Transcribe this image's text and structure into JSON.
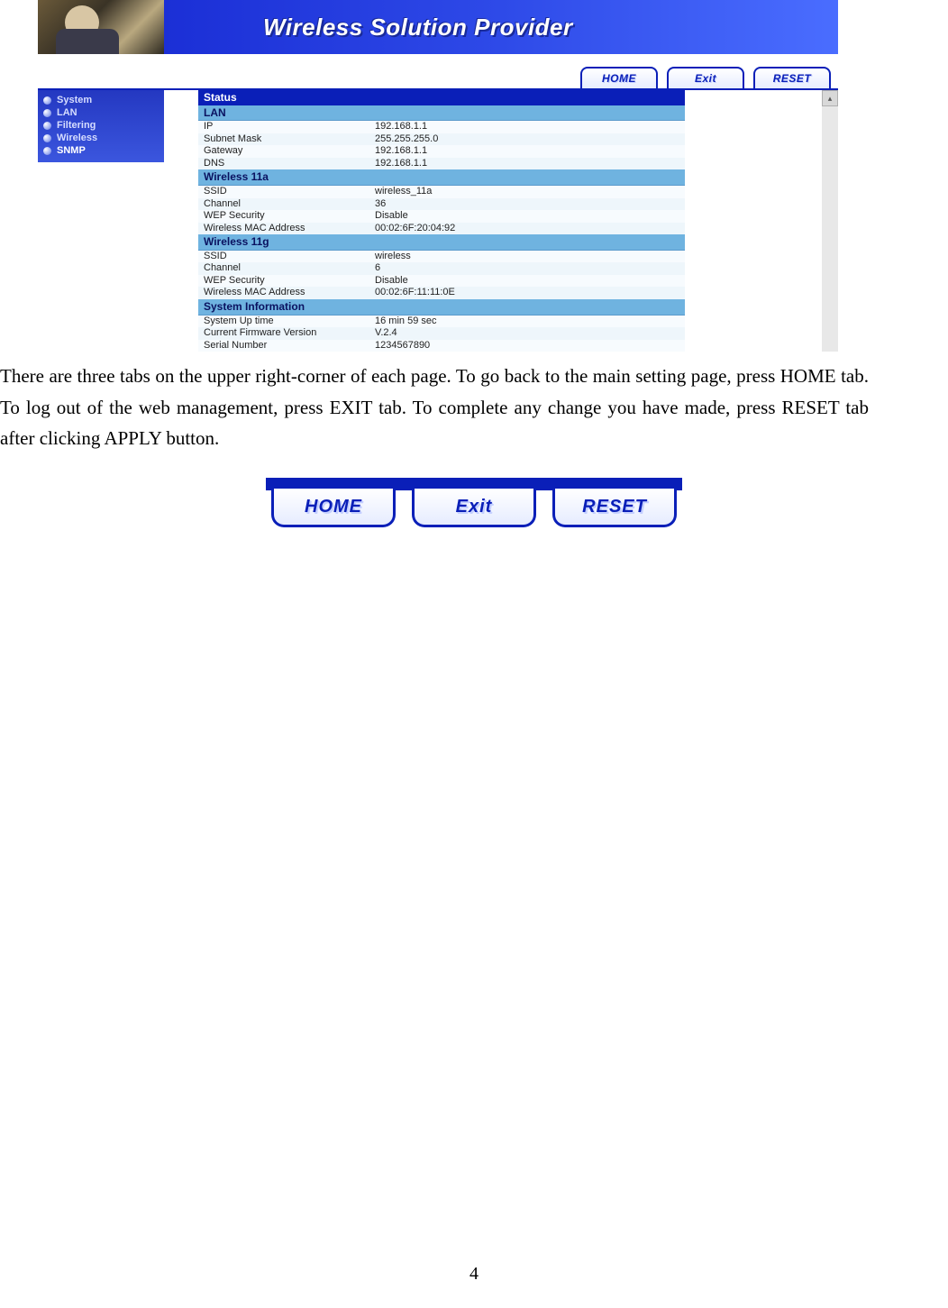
{
  "banner": {
    "title": "Wireless Solution Provider"
  },
  "tabs": {
    "home": "HOME",
    "exit": "Exit",
    "reset": "RESET"
  },
  "sidebar": {
    "items": [
      {
        "label": "System"
      },
      {
        "label": "LAN"
      },
      {
        "label": "Filtering"
      },
      {
        "label": "Wireless"
      },
      {
        "label": "SNMP"
      }
    ]
  },
  "status": {
    "header": "Status",
    "lan": {
      "section": "LAN",
      "ip_k": "IP",
      "ip_v": "192.168.1.1",
      "mask_k": "Subnet Mask",
      "mask_v": "255.255.255.0",
      "gw_k": "Gateway",
      "gw_v": "192.168.1.1",
      "dns_k": "DNS",
      "dns_v": "192.168.1.1"
    },
    "w11a": {
      "section": "Wireless  11a",
      "ssid_k": "SSID",
      "ssid_v": "wireless_11a",
      "ch_k": "Channel",
      "ch_v": "36",
      "wep_k": "WEP Security",
      "wep_v": "Disable",
      "mac_k": "Wireless MAC Address",
      "mac_v": "00:02:6F:20:04:92"
    },
    "w11g": {
      "section": "Wireless  11g",
      "ssid_k": "SSID",
      "ssid_v": "wireless",
      "ch_k": "Channel",
      "ch_v": "6",
      "wep_k": "WEP Security",
      "wep_v": "Disable",
      "mac_k": "Wireless MAC Address",
      "mac_v": "00:02:6F:11:11:0E"
    },
    "sys": {
      "section": "System  Information",
      "up_k": "System Up time",
      "up_v": "16 min 59 sec",
      "fw_k": "Current Firmware Version",
      "fw_v": "V.2.4",
      "sn_k": "Serial Number",
      "sn_v": "1234567890"
    }
  },
  "body": {
    "p1": "There are three tabs on the upper right-corner of each page. To go back to the main setting page, press HOME tab. To log out of the web management, press EXIT tab. To complete any change you have made, press RESET tab after clicking APPLY button."
  },
  "bigtabs": {
    "home": "HOME",
    "exit": "Exit",
    "reset": "RESET"
  },
  "page_number": "4"
}
